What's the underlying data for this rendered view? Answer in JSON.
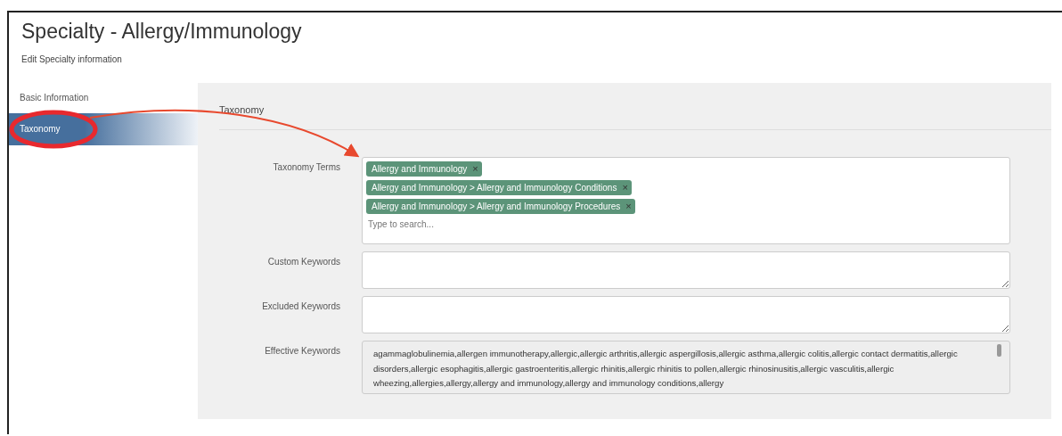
{
  "header": {
    "title": "Specialty - Allergy/Immunology",
    "subtitle": "Edit Specialty information"
  },
  "sidebar": {
    "items": [
      {
        "label": "Basic Information",
        "selected": false
      },
      {
        "label": "Taxonomy",
        "selected": true
      }
    ]
  },
  "section": {
    "title": "Taxonomy"
  },
  "fields": [
    {
      "kind": "tags",
      "label": "Taxonomy Terms",
      "tags": [
        {
          "label": "Allergy and Immunology",
          "remove": "×"
        },
        {
          "label": "Allergy and Immunology > Allergy and Immunology Conditions",
          "remove": "×"
        },
        {
          "label": "Allergy and Immunology > Allergy and Immunology Procedures",
          "remove": "×"
        }
      ],
      "placeholder": "Type to search..."
    },
    {
      "kind": "textarea",
      "label": "Custom Keywords"
    },
    {
      "kind": "textarea",
      "label": "Excluded Keywords"
    },
    {
      "kind": "readonly",
      "label": "Effective Keywords",
      "value": "agammaglobulinemia,allergen immunotherapy,allergic,allergic arthritis,allergic aspergillosis,allergic asthma,allergic colitis,allergic contact dermatitis,allergic disorders,allergic esophagitis,allergic gastroenteritis,allergic rhinitis,allergic rhinitis to pollen,allergic rhinosinusitis,allergic vasculitis,allergic wheezing,allergies,allergy,allergy and immunology,allergy and immunology conditions,allergy"
    }
  ]
}
